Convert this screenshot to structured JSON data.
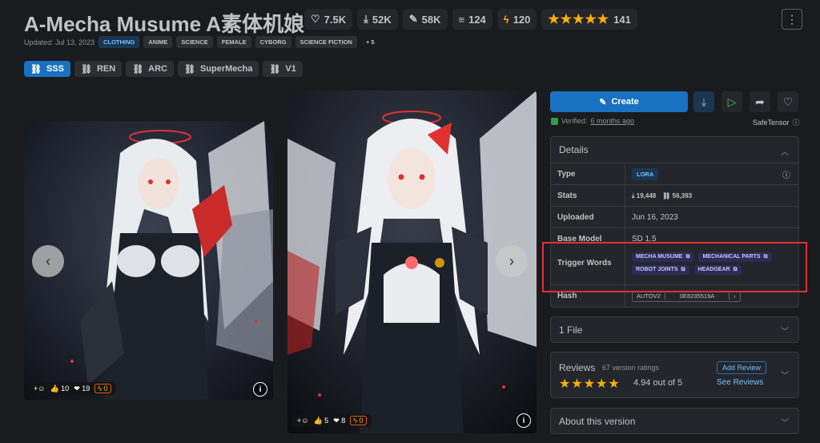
{
  "model": {
    "title": "A-Mecha Musume A素体机娘",
    "updated": "Updated: Jul 13, 2023"
  },
  "stats": {
    "likes": "7.5K",
    "downloads": "52K",
    "generations": "58K",
    "collections": "124",
    "buzz": "120",
    "rating_count": "141"
  },
  "tags": [
    "CLOTHING",
    "ANIME",
    "SCIENCE",
    "FEMALE",
    "CYBORG",
    "SCIENCE FICTION",
    "+ 5"
  ],
  "versions": [
    "SSS",
    "REN",
    "ARC",
    "SuperMecha",
    "V1"
  ],
  "gallery": {
    "left": {
      "likes": "10",
      "hearts": "19",
      "buzz": "0"
    },
    "right": {
      "likes": "5",
      "hearts": "8",
      "buzz": "0"
    }
  },
  "actions": {
    "create_label": "Create",
    "verified_prefix": "Verified:",
    "verified_when": "6 months ago",
    "safetensor": "SafeTensor"
  },
  "details": {
    "header": "Details",
    "type_label": "Type",
    "type_value": "LORA",
    "stats_label": "Stats",
    "stats_downloads": "19,448",
    "stats_generations": "56,393",
    "uploaded_label": "Uploaded",
    "uploaded_value": "Jun 16, 2023",
    "base_model_label": "Base Model",
    "base_model_value": "SD 1.5",
    "trigger_label": "Trigger Words",
    "trigger_words": [
      "MECHA MUSUME",
      "MECHANICAL PARTS",
      "ROBOT JOINTS",
      "HEADGEAR"
    ],
    "hash_label": "Hash",
    "hash_type": "AUTOV2",
    "hash_value": "0E8235519A"
  },
  "files": {
    "label": "1 File"
  },
  "reviews": {
    "label": "Reviews",
    "ratings_text": "67 version ratings",
    "add_review": "Add Review",
    "see_reviews": "See Reviews",
    "score_text": "4.94 out of 5"
  },
  "about": {
    "label": "About this version"
  },
  "colors": {
    "accent": "#1971c2",
    "star": "#fab005",
    "highlight": "#e03131",
    "background": "#1a1b1e"
  }
}
